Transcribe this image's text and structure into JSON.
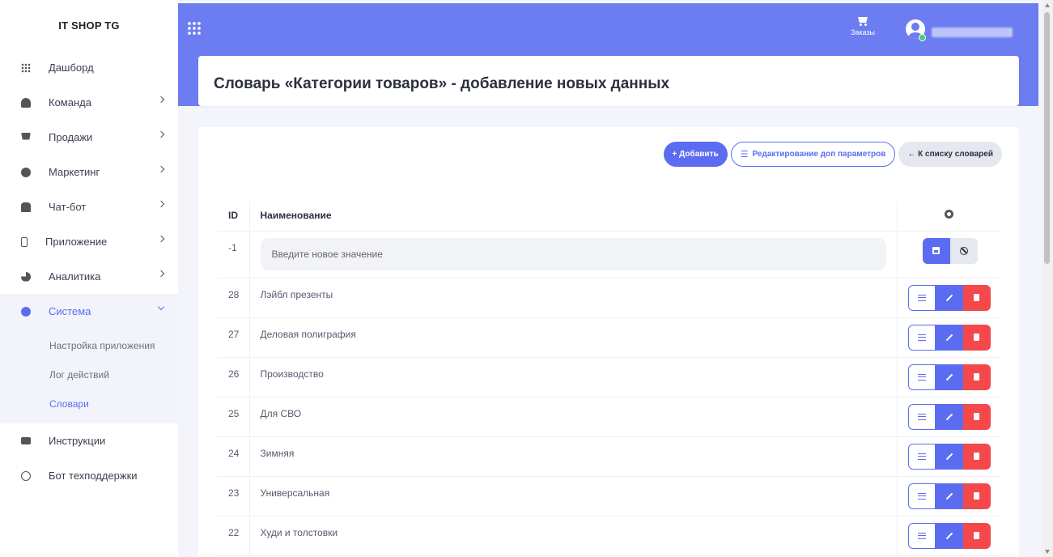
{
  "brand": "IT SHOP TG",
  "sidebar": {
    "items": [
      {
        "label": "Дашборд"
      },
      {
        "label": "Команда"
      },
      {
        "label": "Продажи"
      },
      {
        "label": "Маркетинг"
      },
      {
        "label": "Чат-бот"
      },
      {
        "label": "Приложение"
      },
      {
        "label": "Аналитика"
      },
      {
        "label": "Система"
      },
      {
        "label": "Инструкции"
      },
      {
        "label": "Бот техподдержки"
      }
    ],
    "subitems": [
      {
        "label": "Настройка приложения"
      },
      {
        "label": "Лог действий"
      },
      {
        "label": "Словари"
      }
    ]
  },
  "topbar": {
    "orders_label": "Заказы"
  },
  "page": {
    "title": "Словарь «Категории товаров» - добавление новых данных"
  },
  "toolbar": {
    "add_label": "+ Добавить",
    "edit_params_label": "Редактирование доп параметров",
    "back_label": "← К списку словарей"
  },
  "table": {
    "headers": {
      "id": "ID",
      "name": "Наименование"
    },
    "new_row": {
      "id": "-1",
      "placeholder": "Введите новое значение"
    },
    "rows": [
      {
        "id": "28",
        "name": "Лэйбл презенты"
      },
      {
        "id": "27",
        "name": "Деловая полиграфия"
      },
      {
        "id": "26",
        "name": "Производство"
      },
      {
        "id": "25",
        "name": "Для СВО"
      },
      {
        "id": "24",
        "name": "Зимняя"
      },
      {
        "id": "23",
        "name": "Универсальная"
      },
      {
        "id": "22",
        "name": "Худи и толстовки"
      }
    ]
  },
  "colors": {
    "accent": "#6c7cf1",
    "primary": "#5b6cf0",
    "danger": "#f5484a",
    "online": "#3ad16b"
  }
}
